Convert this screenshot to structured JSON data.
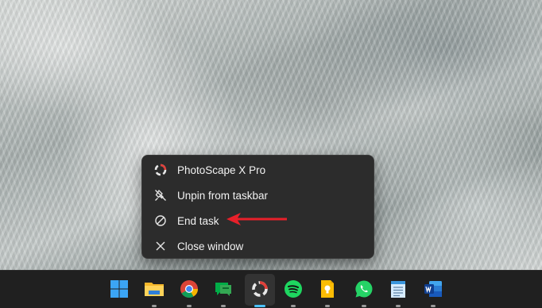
{
  "context_menu": {
    "app_title": "PhotoScape X Pro",
    "items": [
      {
        "label": "Unpin from taskbar",
        "icon": "unpin-icon"
      },
      {
        "label": "End task",
        "icon": "end-task-icon"
      },
      {
        "label": "Close window",
        "icon": "close-icon"
      }
    ]
  },
  "annotation": {
    "arrow_color": "#e8202a"
  },
  "taskbar": {
    "icons": [
      "windows-start-icon",
      "file-explorer-icon",
      "chrome-icon",
      "google-chat-icon",
      "photoscape-icon",
      "spotify-icon",
      "keep-icon",
      "whatsapp-icon",
      "notepad-icon",
      "word-icon"
    ],
    "accent_color": "#4cc2ff"
  }
}
